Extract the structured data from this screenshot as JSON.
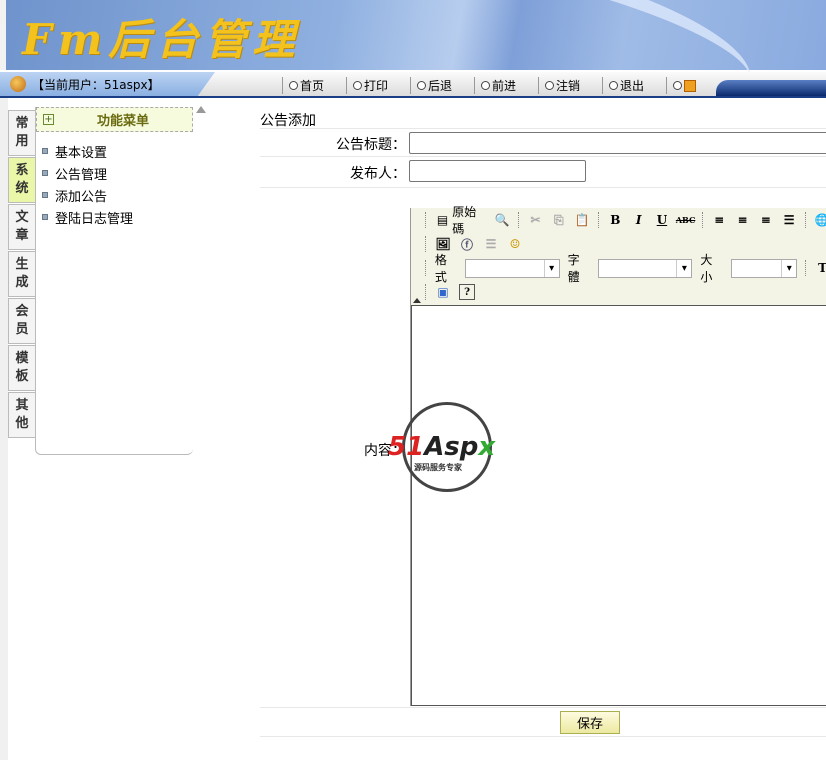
{
  "header": {
    "logo_text": "Fm后台管理"
  },
  "navbar": {
    "current_user": "【当前用户：51aspx】",
    "items": [
      "首页",
      "打印",
      "后退",
      "前进",
      "注销",
      "退出"
    ]
  },
  "sidebar": {
    "tabs": [
      [
        "常",
        "用"
      ],
      [
        "系",
        "统"
      ],
      [
        "文",
        "章"
      ],
      [
        "生",
        "成"
      ],
      [
        "会",
        "员"
      ],
      [
        "模",
        "板"
      ],
      [
        "其",
        "他"
      ]
    ],
    "active_tab": 1,
    "menu_title": "功能菜单",
    "menu_items": [
      "基本设置",
      "公告管理",
      "添加公告",
      "登陆日志管理"
    ]
  },
  "form": {
    "title": "公告添加",
    "title_label": "公告标题：",
    "title_value": "",
    "author_label": "发布人：",
    "author_value": "",
    "content_label": "内容：",
    "save": "保存"
  },
  "editor": {
    "source_label": "原始碼",
    "format_label": "格式",
    "font_label": "字體",
    "size_label": "大小"
  },
  "watermark": {
    "brand": "51Aspx",
    "slogan": "源码服务专家"
  }
}
